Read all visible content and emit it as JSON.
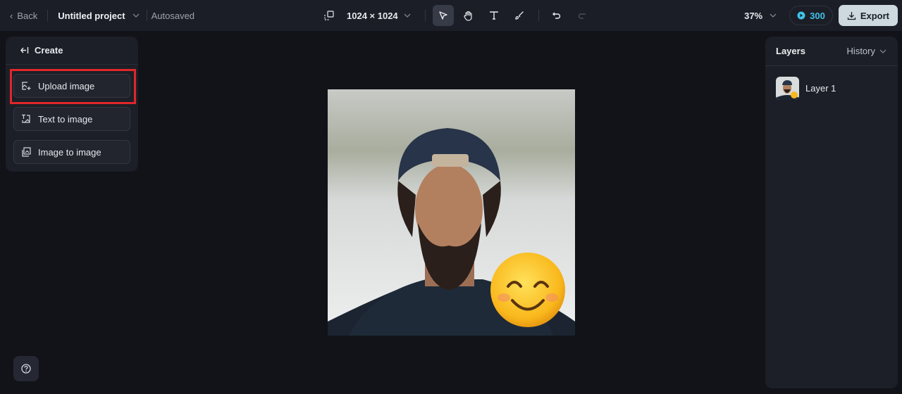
{
  "topbar": {
    "back_label": "Back",
    "project_title": "Untitled project",
    "save_status": "Autosaved",
    "canvas_size": "1024 × 1024",
    "zoom_level": "37%",
    "credits": "300",
    "export_label": "Export",
    "accent_color": "#3fc2e8"
  },
  "create_panel": {
    "title": "Create",
    "options": [
      {
        "label": "Upload image",
        "icon": "upload-image-icon",
        "highlighted": true
      },
      {
        "label": "Text to image",
        "icon": "text-to-image-icon"
      },
      {
        "label": "Image to image",
        "icon": "image-to-image-icon"
      }
    ]
  },
  "layers_panel": {
    "title": "Layers",
    "history_label": "History",
    "layers": [
      {
        "name": "Layer 1"
      }
    ]
  },
  "canvas": {
    "image_description": "Portrait of bearded man in backward cap with smiling emoji sticker"
  }
}
